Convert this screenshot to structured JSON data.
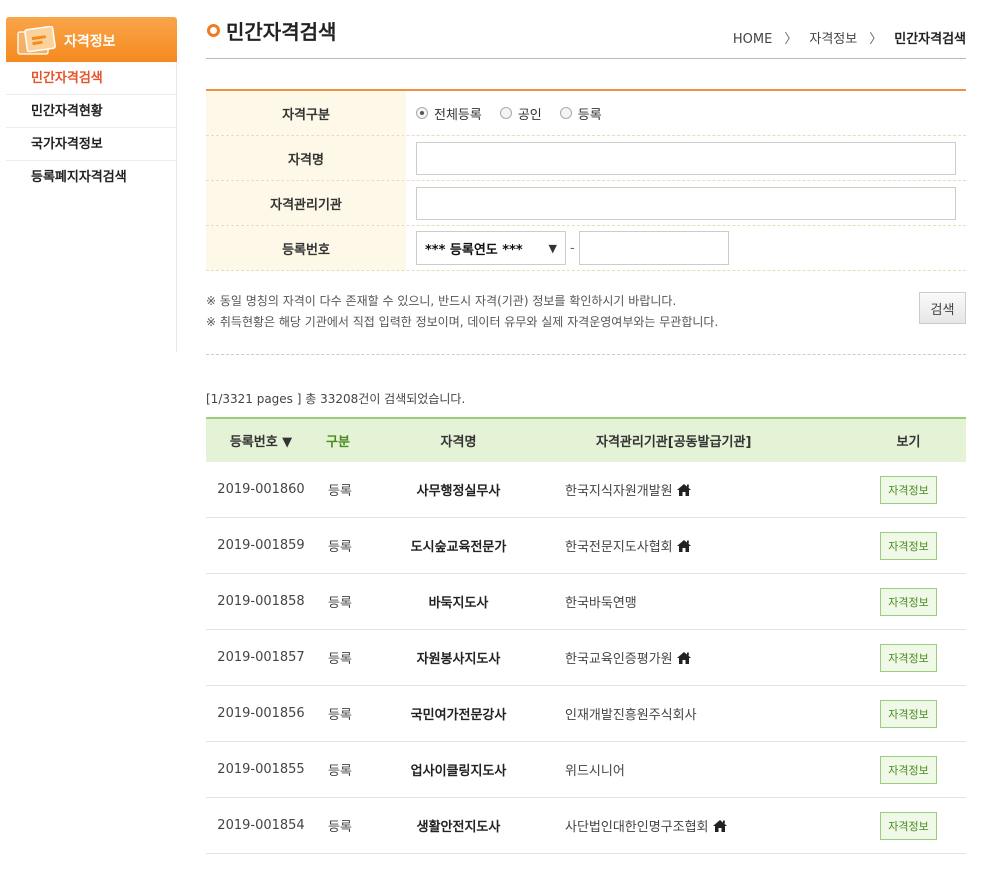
{
  "sidebar": {
    "header": "자격정보",
    "items": [
      {
        "label": "민간자격검색",
        "active": true
      },
      {
        "label": "민간자격현황",
        "active": false
      },
      {
        "label": "국가자격정보",
        "active": false
      },
      {
        "label": "등록폐지자격검색",
        "active": false
      }
    ]
  },
  "header": {
    "title": "민간자격검색",
    "breadcrumb": [
      "HOME",
      "자격정보",
      "민간자격검색"
    ]
  },
  "form": {
    "type_label": "자격구분",
    "radios": [
      {
        "label": "전체등록",
        "checked": true
      },
      {
        "label": "공인",
        "checked": false
      },
      {
        "label": "등록",
        "checked": false
      }
    ],
    "name_label": "자격명",
    "org_label": "자격관리기관",
    "regno_label": "등록번호",
    "year_select": "*** 등록연도 ***",
    "regno_dash": "-",
    "notes": [
      "※ 동일 명칭의 자격이 다수 존재할 수 있으니, 반드시 자격(기관) 정보를 확인하시기 바랍니다.",
      "※ 취득현황은 해당 기관에서 직접 입력한 정보이며, 데이터 유무와 실제 자격운영여부와는 무관합니다."
    ],
    "search_button": "검색"
  },
  "results": {
    "summary": "[1/3321 pages ] 총 33208건이 검색되었습니다.",
    "columns": [
      "등록번호 ▼",
      "구분",
      "자격명",
      "자격관리기관[공동발급기관]",
      "보기"
    ],
    "view_button": "자격정보",
    "rows": [
      {
        "regno": "2019-001860",
        "type": "등록",
        "name": "사무행정실무사",
        "org": "한국지식자원개발원",
        "home": true
      },
      {
        "regno": "2019-001859",
        "type": "등록",
        "name": "도시숲교육전문가",
        "org": "한국전문지도사협회",
        "home": true
      },
      {
        "regno": "2019-001858",
        "type": "등록",
        "name": "바둑지도사",
        "org": "한국바둑연맹",
        "home": false
      },
      {
        "regno": "2019-001857",
        "type": "등록",
        "name": "자원봉사지도사",
        "org": "한국교육인증평가원",
        "home": true
      },
      {
        "regno": "2019-001856",
        "type": "등록",
        "name": "국민여가전문강사",
        "org": "인재개발진흥원주식회사",
        "home": false
      },
      {
        "regno": "2019-001855",
        "type": "등록",
        "name": "업사이클링지도사",
        "org": "위드시니어",
        "home": false
      },
      {
        "regno": "2019-001854",
        "type": "등록",
        "name": "생활안전지도사",
        "org": "사단법인대한인명구조협회",
        "home": true
      }
    ]
  }
}
